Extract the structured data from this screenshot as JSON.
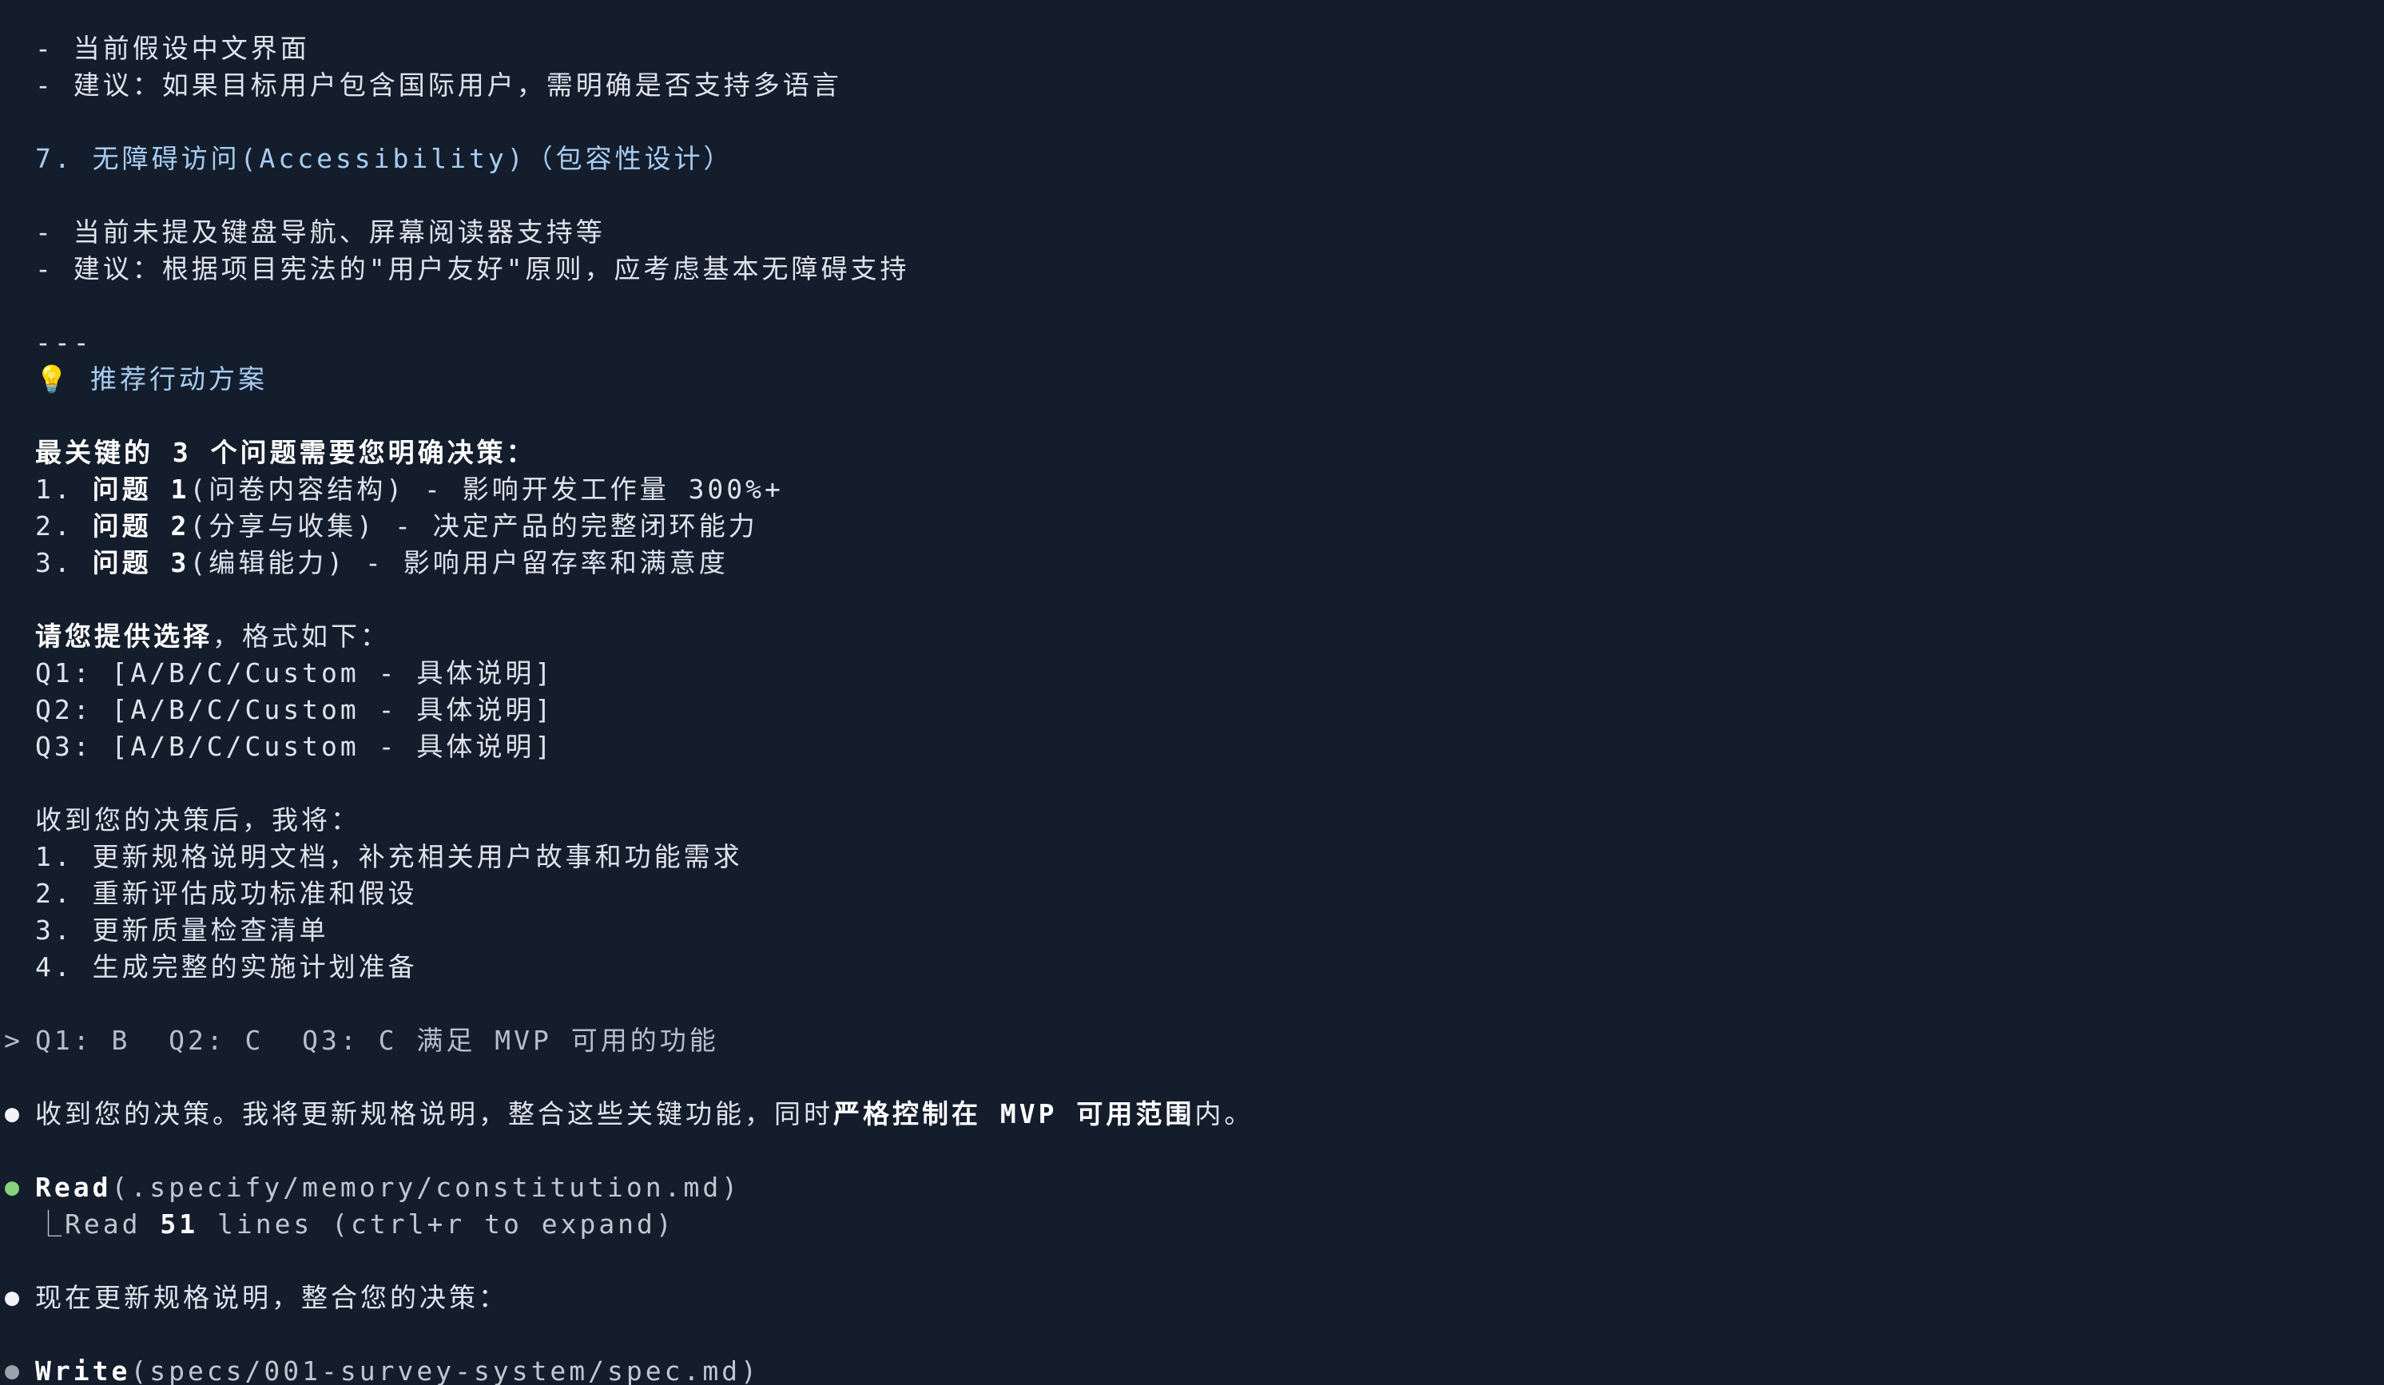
{
  "lines": {
    "l1": "- 当前假设中文界面",
    "l2": "- 建议：如果目标用户包含国际用户，需明确是否支持多语言",
    "h7": "7. 无障碍访问(Accessibility)（包容性设计）",
    "l3": "- 当前未提及键盘导航、屏幕阅读器支持等",
    "l4": "- 建议：根据项目宪法的\"用户友好\"原则，应考虑基本无障碍支持",
    "sep": "---",
    "rec_icon": "💡",
    "rec_title": "推荐行动方案",
    "key_title": "最关键的 3 个问题需要您明确决策：",
    "q1_prefix": "1. ",
    "q1_bold": "问题 1",
    "q1_rest": "(问卷内容结构) - 影响开发工作量 300%+",
    "q2_prefix": "2. ",
    "q2_bold": "问题 2",
    "q2_rest": "(分享与收集) - 决定产品的完整闭环能力",
    "q3_prefix": "3. ",
    "q3_bold": "问题 3",
    "q3_rest": "(编辑能力) - 影响用户留存率和满意度",
    "choose_bold": "请您提供选择",
    "choose_rest": "，格式如下：",
    "fmt1": "Q1: [A/B/C/Custom - 具体说明]",
    "fmt2": "Q2: [A/B/C/Custom - 具体说明]",
    "fmt3": "Q3: [A/B/C/Custom - 具体说明]",
    "after": "收到您的决策后，我将：",
    "a1": "1. 更新规格说明文档，补充相关用户故事和功能需求",
    "a2": "2. 重新评估成功标准和假设",
    "a3": "3. 更新质量检查清单",
    "a4": "4. 生成完整的实施计划准备"
  },
  "prompt": {
    "caret": ">",
    "text": "Q1: B  Q2: C  Q3: C 满足 MVP 可用的功能"
  },
  "messages": {
    "m1_pre": "收到您的决策。我将更新规格说明，整合这些关键功能，同时",
    "m1_bold": "严格控制在 MVP 可用范围",
    "m1_post": "内。",
    "read_tool": "Read",
    "read_args": "(.specify/memory/constitution.md)",
    "read_result_pre": "⎿Read ",
    "read_result_bold": "51",
    "read_result_post": " lines (ctrl+r to expand)",
    "m2": "现在更新规格说明，整合您的决策：",
    "write_tool": "Write",
    "write_args": "(specs/001-survey-system/spec.md)"
  },
  "bullets": {
    "dot": "●"
  },
  "colors": {
    "background": "#141d2c",
    "heading": "#a7cdf2",
    "bullet_green": "#87d37c"
  }
}
